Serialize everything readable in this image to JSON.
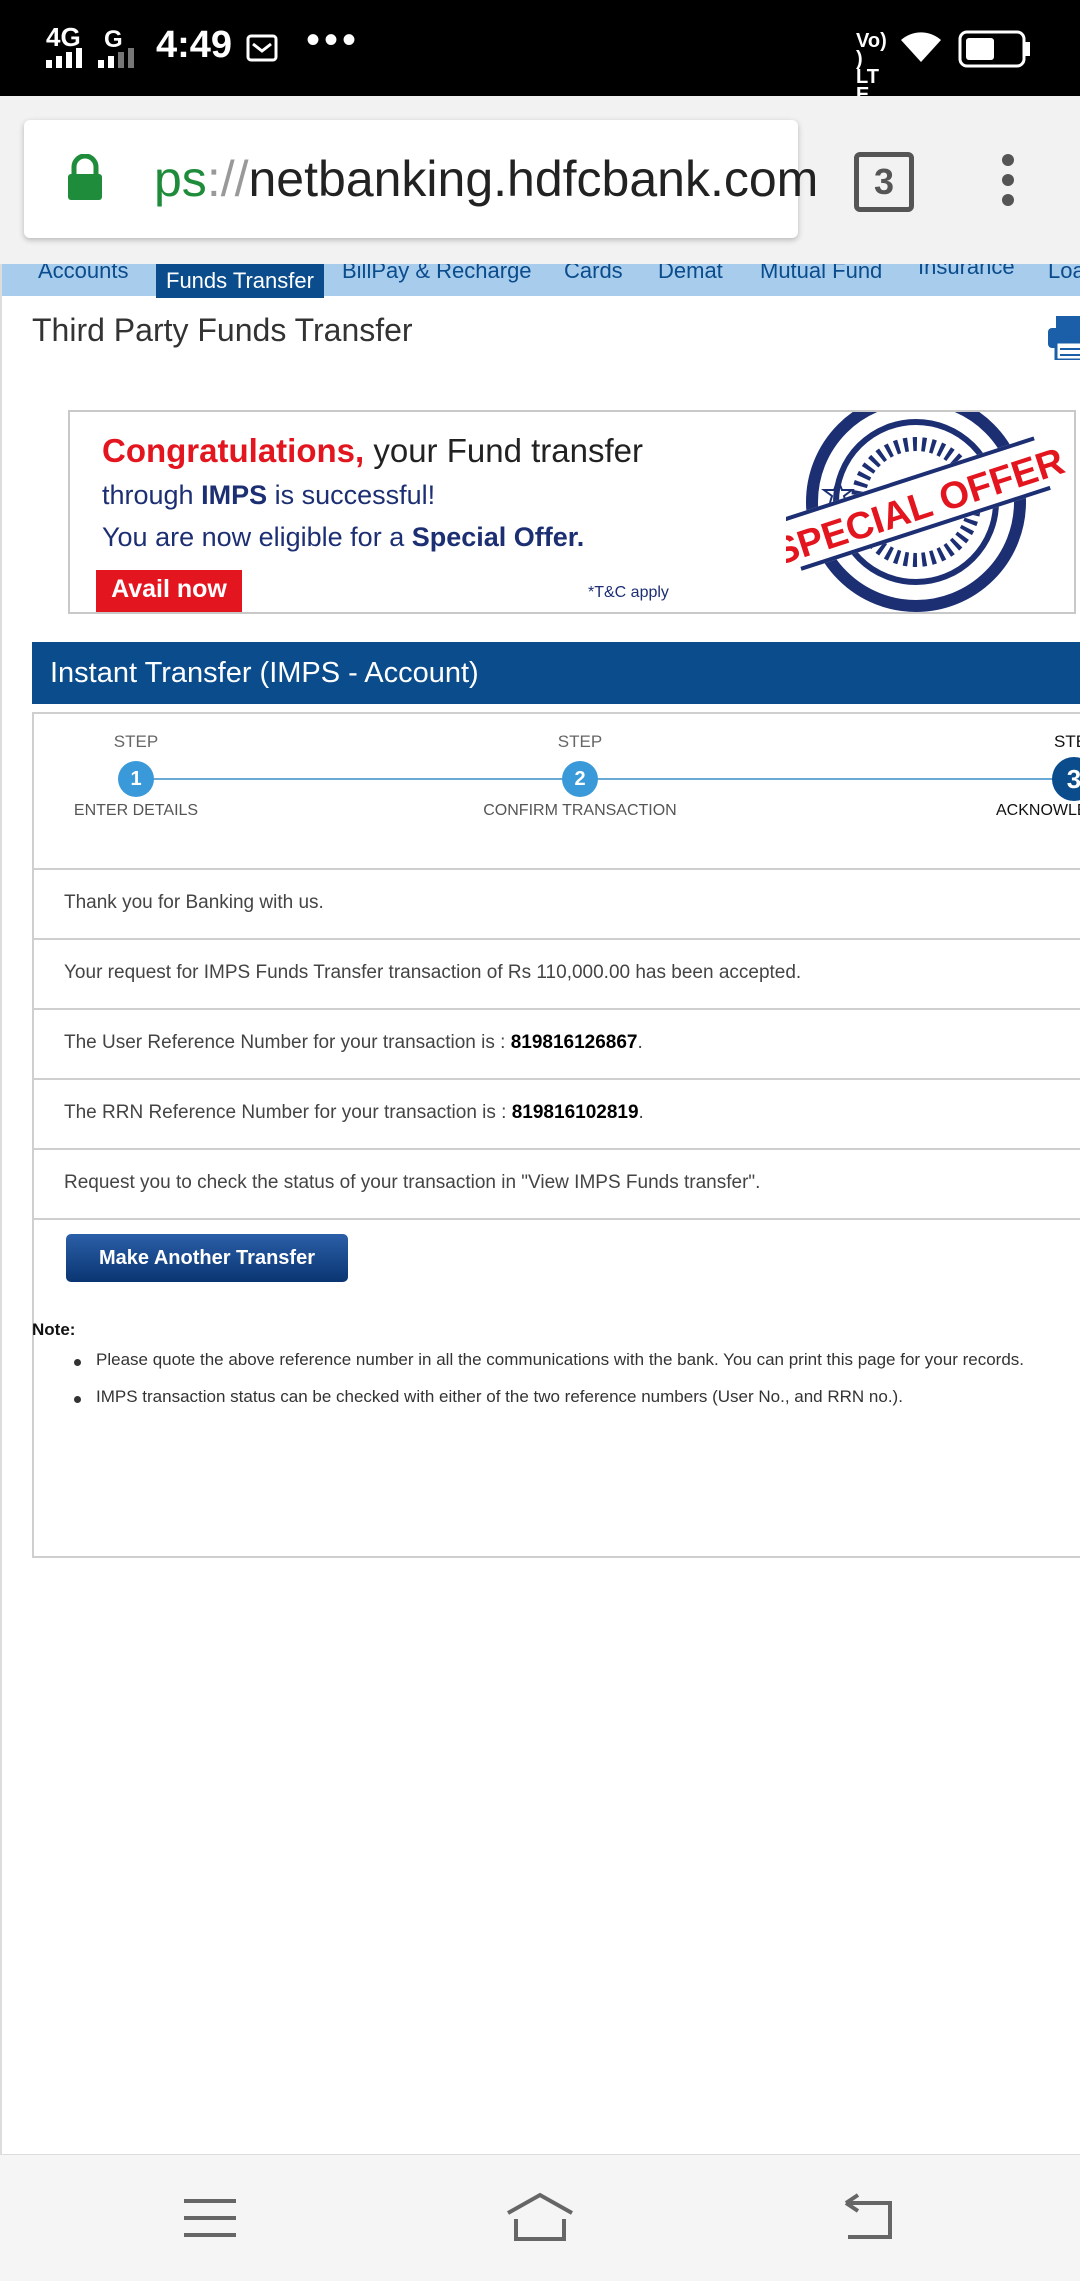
{
  "status_bar": {
    "network": "4G",
    "network2": "G",
    "time": "4:49",
    "overflow": "•••",
    "volte": "Vo)) LTE",
    "icons": [
      "signal-icon",
      "signal-icon",
      "mail-icon",
      "wifi-icon",
      "battery-icon"
    ]
  },
  "browser": {
    "url_scheme": "ps",
    "url_sep": "://",
    "url_host": "netbanking.hdfcbank.com",
    "tab_count": "3",
    "accent": "#1e8c3a"
  },
  "nav": {
    "items": [
      "Accounts",
      "Funds Transfer",
      "BillPay & Recharge",
      "Cards",
      "Demat",
      "Mutual Fund",
      "Insurance",
      "Loa"
    ],
    "active": "Funds Transfer",
    "bg_color": "#a8ccec",
    "active_color": "#0a4c8c"
  },
  "page": {
    "title": "Third Party Funds Transfer"
  },
  "banner": {
    "congrats": "Congratulations,",
    "line1_rest": "your Fund transfer",
    "line2_a": "through ",
    "line2_b": "IMPS",
    "line2_c": " is successful!",
    "line3_a": "You are now eligible for a ",
    "line3_b": "Special Offer.",
    "avail": "Avail now",
    "tandc": "*T&C apply",
    "seal_text": "SPECIAL OFFER",
    "seal_ring": "SPECIAL OFFER"
  },
  "imps": {
    "header": "Instant Transfer (IMPS - Account)",
    "steps": [
      {
        "label": "STEP",
        "number": "1",
        "caption": "ENTER DETAILS"
      },
      {
        "label": "STEP",
        "number": "2",
        "caption": "CONFIRM TRANSACTION"
      },
      {
        "label": "STE",
        "number": "3",
        "caption": "ACKNOWLE"
      }
    ],
    "rows": {
      "thanks": "Thank you for Banking with us.",
      "accepted": "Your request for IMPS Funds Transfer transaction of Rs 110,000.00 has been accepted.",
      "user_ref_prefix": "The User Reference Number for your transaction is : ",
      "user_ref": "819816126867",
      "rrn_prefix": "The RRN Reference Number for your transaction is : ",
      "rrn_ref": "819816102819",
      "period": ".",
      "status": "Request you to check the status of your transaction in \"View IMPS Funds transfer\"."
    },
    "button": "Make Another Transfer"
  },
  "note": {
    "label": "Note:",
    "items": [
      "Please quote the above reference number in all the communications with the bank. You can print this page for your records.",
      "IMPS transaction status can be checked with either of the two reference numbers (User No., and RRN no.)."
    ]
  },
  "navbar": {
    "icons": [
      "menu-icon",
      "home-icon",
      "back-icon"
    ]
  }
}
